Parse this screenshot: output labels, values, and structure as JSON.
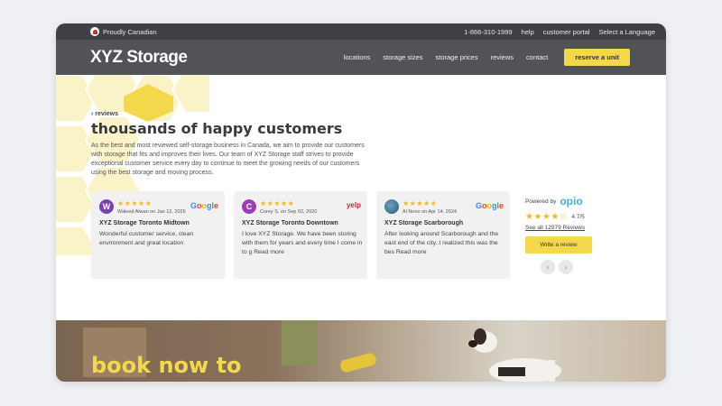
{
  "topbar": {
    "tagline": "Proudly Canadian",
    "phone": "1-866-310-1999",
    "help": "help",
    "portal": "customer portal",
    "language": "Select a Language"
  },
  "nav": {
    "logo": "XYZ Storage",
    "links": [
      "locations",
      "storage sizes",
      "storage prices",
      "reviews",
      "contact"
    ],
    "cta": "reserve a unit"
  },
  "hero": {
    "breadcrumb": "› reviews",
    "headline": "thousands of happy customers",
    "intro": "As the best and most reviewed self-storage business in Canada, we aim to provide our customers with storage that fits and improves their lives. Our team of XYZ Storage staff strives to provide exceptional customer service every day to continue to meet the growing needs of our customers using the best storage and moving process."
  },
  "reviews": [
    {
      "initial": "W",
      "avatar_color": "#7b3fb7",
      "stars": "★★★★★",
      "meta": "Waleed Alwan on Jan 12, 2026",
      "source": "Google",
      "location": "XYZ Storage Toronto Midtown",
      "text": "Wonderful customer service, clean environment and great location"
    },
    {
      "initial": "C",
      "avatar_color": "#9a3fb3",
      "stars": "★★★★★",
      "meta": "Corey S. on Sep 02, 2020",
      "source": "yelp",
      "location": "XYZ Storage Toronto Downtown",
      "text": "I love XYZ Storage. We have been storing with them for years and every time I come in to g Read more"
    },
    {
      "initial": "",
      "avatar_color": "#3d6b8a",
      "stars": "★★★★★",
      "meta": "Al Neno on Apr 14, 2024",
      "source": "Google",
      "location": "XYZ Storage Scarborough",
      "text": "After looking around Scarborough and the east end of the city..I realized this was the bes Read more"
    }
  ],
  "widget": {
    "powered": "Powered by",
    "brand": "opio",
    "stars": "★★★★☆",
    "rating": "4.7/5",
    "see_all": "See all 12979 Reviews",
    "write": "Write a review"
  },
  "banner": {
    "title": "book now to"
  },
  "colors": {
    "accent": "#f3d84b",
    "nav_bg": "#525356",
    "topbar_bg": "#3f4043"
  }
}
